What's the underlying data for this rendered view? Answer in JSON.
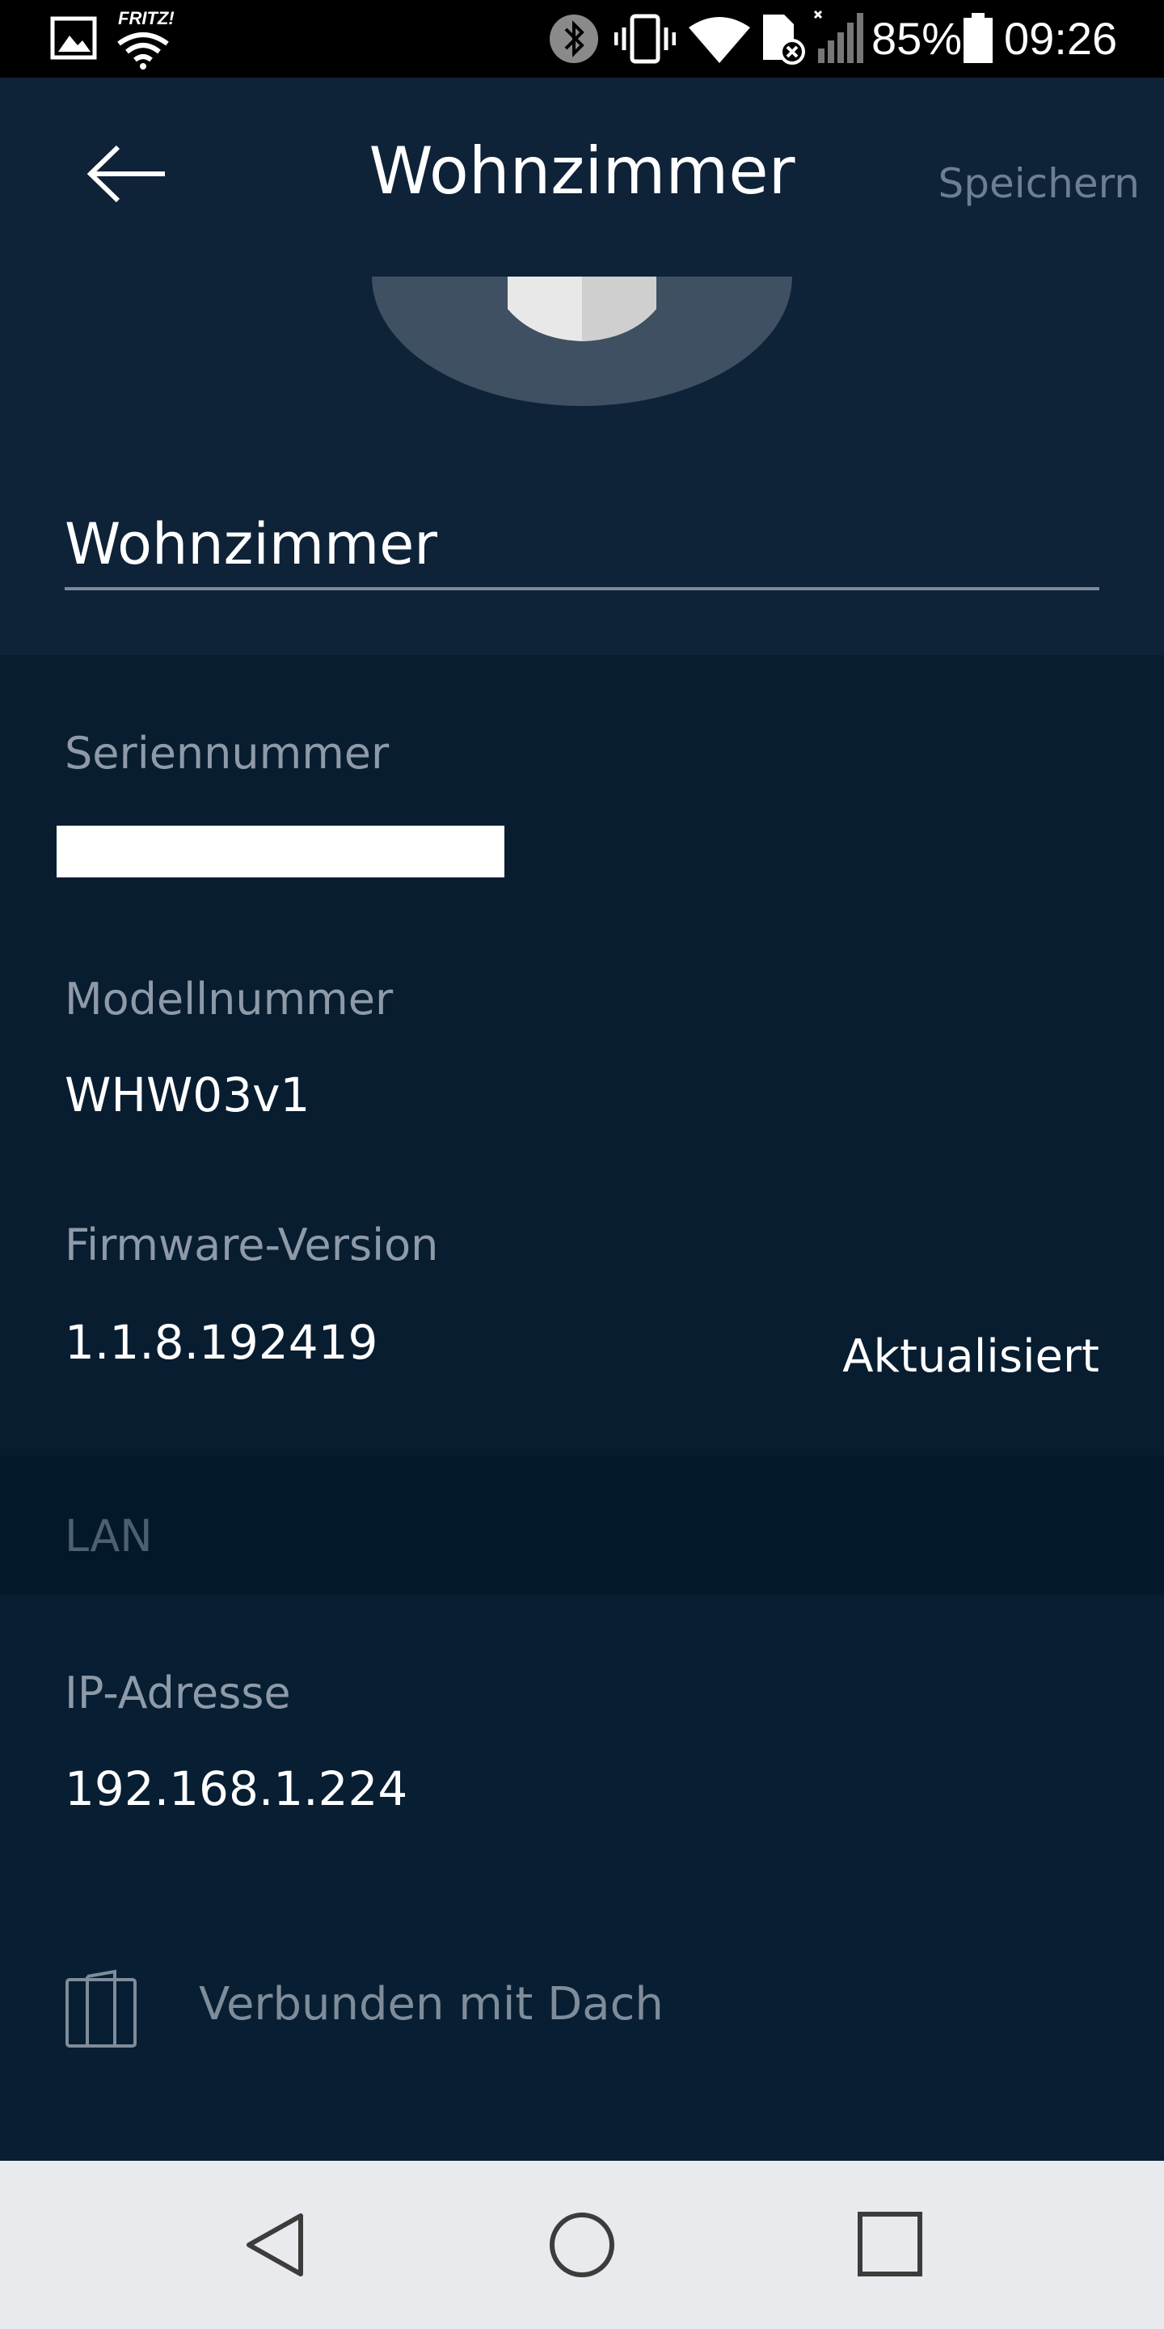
{
  "status_bar": {
    "battery": "85%",
    "time": "09:26",
    "icons": [
      "image-icon",
      "fritz-wifi-icon",
      "bluetooth-icon",
      "vibrate-icon",
      "wifi-icon",
      "sim-off-icon",
      "signal-icon",
      "battery-icon"
    ],
    "fritz_label": "FRITZ!"
  },
  "header": {
    "title": "Wohnzimmer",
    "save_label": "Speichern",
    "back_icon": "arrow-left-icon"
  },
  "device": {
    "name_value": "Wohnzimmer"
  },
  "details": {
    "serial_label": "Seriennummer",
    "model_label": "Modellnummer",
    "model_value": "WHW03v1",
    "firmware_label": "Firmware-Version",
    "firmware_value": "1.1.8.192419",
    "firmware_status": "Aktualisiert"
  },
  "lan": {
    "section_title": "LAN",
    "ip_label": "IP-Adresse",
    "ip_value": "192.168.1.224",
    "connection_label": "Verbunden mit Dach",
    "connection_icon": "node-icon"
  },
  "nav": {
    "icons": [
      "back-triangle-icon",
      "home-circle-icon",
      "recents-square-icon"
    ]
  },
  "colors": {
    "header_bg": "#0e2238",
    "content_bg": "#091d31",
    "lan_header_bg": "#031929",
    "nav_bg": "#e9eaee",
    "muted_text": "#8e9aa8"
  }
}
